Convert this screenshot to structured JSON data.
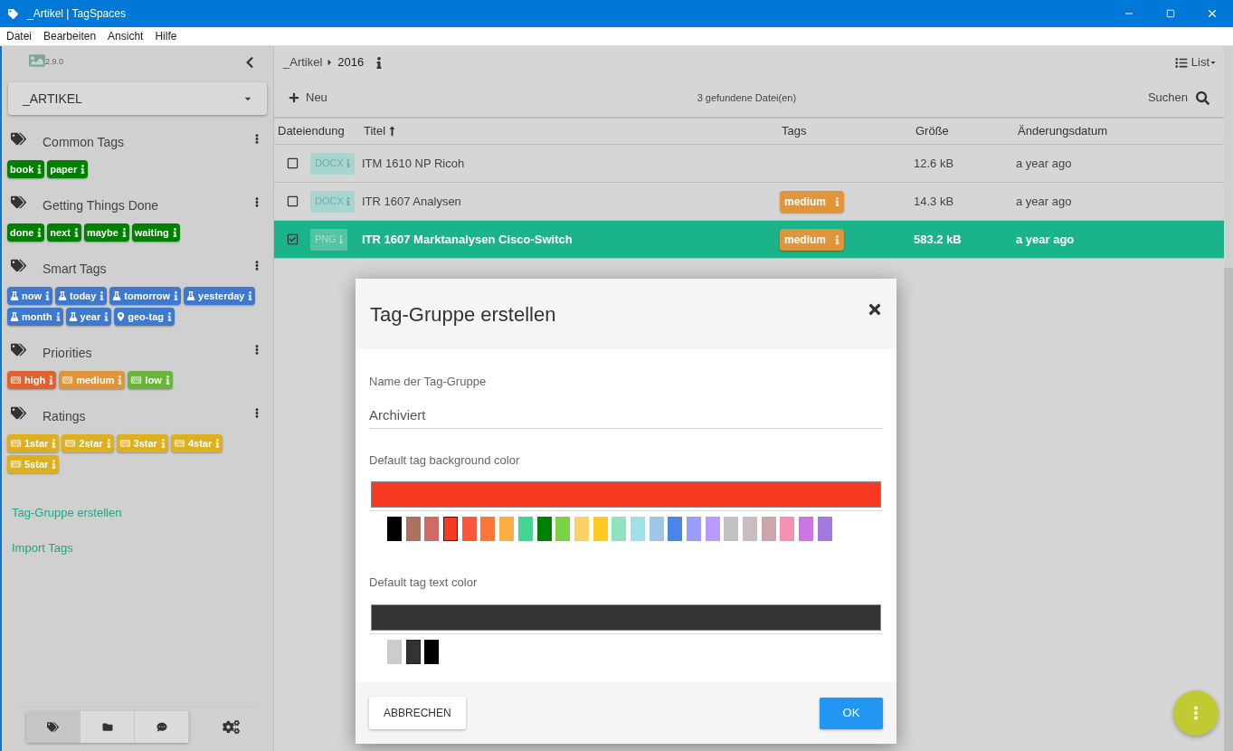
{
  "window": {
    "title": "_Artikel | TagSpaces"
  },
  "menu": [
    "Datei",
    "Bearbeiten",
    "Ansicht",
    "Hilfe"
  ],
  "sidebar": {
    "version": "2.9.0",
    "location": "_ARTIKEL",
    "groups": [
      {
        "title": "Common Tags",
        "tags": [
          {
            "label": "book",
            "color": "#008000",
            "kind": "plain"
          },
          {
            "label": "paper",
            "color": "#008000",
            "kind": "plain"
          }
        ]
      },
      {
        "title": "Getting Things Done",
        "tags": [
          {
            "label": "done",
            "color": "#008000",
            "kind": "plain"
          },
          {
            "label": "next",
            "color": "#008000",
            "kind": "plain"
          },
          {
            "label": "maybe",
            "color": "#008000",
            "kind": "plain"
          },
          {
            "label": "waiting",
            "color": "#008000",
            "kind": "plain"
          }
        ]
      },
      {
        "title": "Smart Tags",
        "tags": [
          {
            "label": "now",
            "color": "#3e79d0",
            "kind": "smart"
          },
          {
            "label": "today",
            "color": "#3e79d0",
            "kind": "smart"
          },
          {
            "label": "tomorrow",
            "color": "#3e79d0",
            "kind": "smart"
          },
          {
            "label": "yesterday",
            "color": "#3e79d0",
            "kind": "smart"
          },
          {
            "label": "month",
            "color": "#3e79d0",
            "kind": "smart"
          },
          {
            "label": "year",
            "color": "#3e79d0",
            "kind": "smart"
          },
          {
            "label": "geo-tag",
            "color": "#3e79d0",
            "kind": "geo"
          }
        ]
      },
      {
        "title": "Priorities",
        "tags": [
          {
            "label": "high",
            "color": "#e0622e",
            "kind": "keyboard"
          },
          {
            "label": "medium",
            "color": "#e0953a",
            "kind": "keyboard"
          },
          {
            "label": "low",
            "color": "#6ab53b",
            "kind": "keyboard"
          }
        ]
      },
      {
        "title": "Ratings",
        "tags": [
          {
            "label": "1star",
            "color": "#dcb021",
            "kind": "keyboard"
          },
          {
            "label": "2star",
            "color": "#dcb021",
            "kind": "keyboard"
          },
          {
            "label": "3star",
            "color": "#dcb021",
            "kind": "keyboard"
          },
          {
            "label": "4star",
            "color": "#dcb021",
            "kind": "keyboard"
          },
          {
            "label": "5star",
            "color": "#dcb021",
            "kind": "keyboard"
          }
        ]
      }
    ],
    "links": [
      "Tag-Gruppe erstellen",
      "Import Tags"
    ],
    "bottom_tabs": [
      {
        "kind": "tags",
        "selected": true
      },
      {
        "kind": "folders",
        "selected": false
      },
      {
        "kind": "comments",
        "selected": false
      }
    ]
  },
  "main": {
    "breadcrumb": [
      "_Artikel",
      "2016"
    ],
    "view_button": "List",
    "new_button": "Neu",
    "file_count": "3 gefundene Datei(en)",
    "search_button": "Suchen",
    "columns": [
      {
        "label": "Dateiendung",
        "sorted": false
      },
      {
        "label": "Titel",
        "sorted": true
      },
      {
        "label": "Tags",
        "sorted": false
      },
      {
        "label": "Größe",
        "sorted": false
      },
      {
        "label": "Änderungsdatum",
        "sorted": false
      }
    ],
    "rows": [
      {
        "checked": false,
        "selected": false,
        "extension": "DOCX",
        "title": "ITM 1610 NP Ricoh",
        "tags": [],
        "size": "12.6 kB",
        "modified": "a year ago"
      },
      {
        "checked": false,
        "selected": false,
        "extension": "DOCX",
        "title": "ITR 1607 Analysen",
        "tags": [
          {
            "label": "medium",
            "color": "#e0953a"
          }
        ],
        "size": "14.3 kB",
        "modified": "a year ago"
      },
      {
        "checked": true,
        "selected": true,
        "extension": "PNG",
        "title": "ITR 1607 Marktanalysen Cisco-Switch",
        "tags": [
          {
            "label": "medium",
            "color": "#e0953a"
          }
        ],
        "size": "583.2 kB",
        "modified": "a year ago"
      }
    ]
  },
  "dialog": {
    "title": "Tag-Gruppe erstellen",
    "name_label": "Name der Tag-Gruppe",
    "name_value": "Archiviert",
    "bg_label": "Default tag background color",
    "bg_colors": [
      {
        "color": "#000000",
        "selected": false
      },
      {
        "color": "#ac725e",
        "selected": false
      },
      {
        "color": "#d06b64",
        "selected": false
      },
      {
        "color": "#f83a22",
        "selected": true
      },
      {
        "color": "#fa573c",
        "selected": false
      },
      {
        "color": "#ff7537",
        "selected": false
      },
      {
        "color": "#ffad46",
        "selected": false
      },
      {
        "color": "#42d692",
        "selected": false
      },
      {
        "color": "#008000",
        "selected": false
      },
      {
        "color": "#7bd148",
        "selected": false
      },
      {
        "color": "#fad165",
        "selected": false
      },
      {
        "color": "#ffc920",
        "selected": false
      },
      {
        "color": "#92e1c0",
        "selected": false
      },
      {
        "color": "#9fe1e7",
        "selected": false
      },
      {
        "color": "#9fc6e7",
        "selected": false
      },
      {
        "color": "#4986e7",
        "selected": false
      },
      {
        "color": "#9a9cff",
        "selected": false
      },
      {
        "color": "#b99aff",
        "selected": false
      },
      {
        "color": "#c2c2c2",
        "selected": false
      },
      {
        "color": "#cabdbf",
        "selected": false
      },
      {
        "color": "#cca6ac",
        "selected": false
      },
      {
        "color": "#f691b2",
        "selected": false
      },
      {
        "color": "#cd74e6",
        "selected": false
      },
      {
        "color": "#a47ae2",
        "selected": false
      }
    ],
    "text_label": "Default tag text color",
    "text_colors": [
      {
        "color": "#cccccc",
        "selected": false
      },
      {
        "color": "#333333",
        "selected": true
      },
      {
        "color": "#000000",
        "selected": false
      }
    ],
    "cancel_button": "ABBRECHEN",
    "ok_button": "OK"
  }
}
